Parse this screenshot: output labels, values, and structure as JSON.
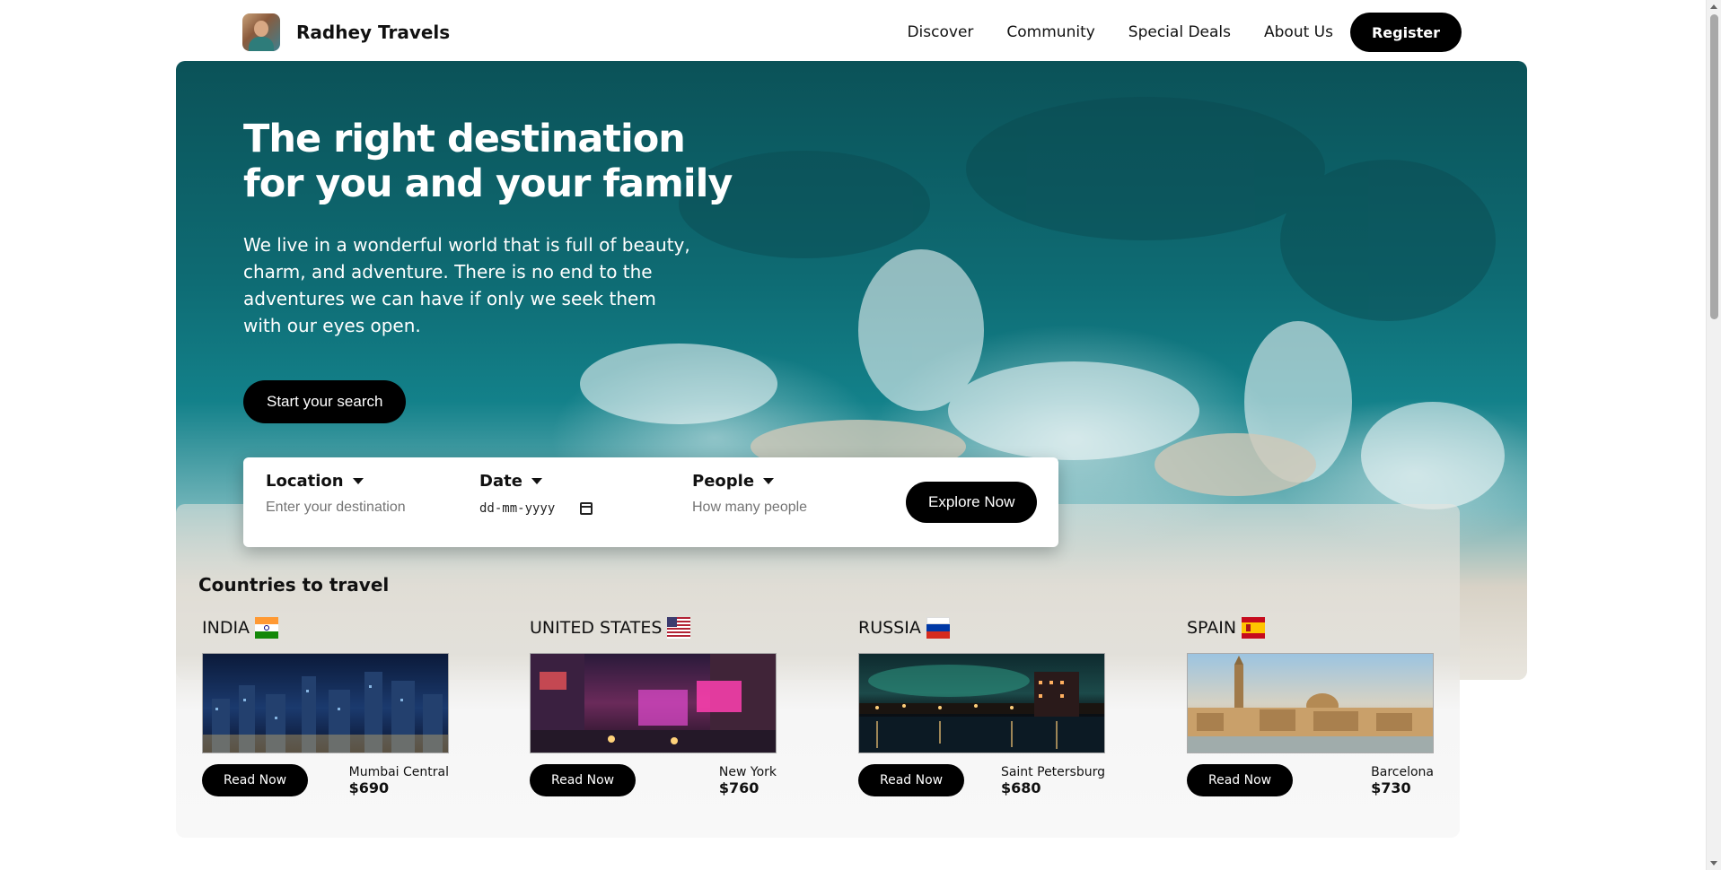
{
  "header": {
    "brand": "Radhey Travels",
    "nav": [
      "Discover",
      "Community",
      "Special Deals",
      "About Us"
    ],
    "register_label": "Register"
  },
  "hero": {
    "title": "The right destination for you and your family",
    "text": "We live in a wonderful world that is full of beauty, charm, and adventure. There is no end to the adventures we can have if only we seek them with our eyes open.",
    "button_label": "Start your search"
  },
  "search": {
    "location_label": "Location",
    "location_placeholder": "Enter your destination",
    "date_label": "Date",
    "date_placeholder": "dd-mm-yyyy",
    "people_label": "People",
    "people_placeholder": "How many people",
    "explore_label": "Explore Now"
  },
  "countries": {
    "title": "Countries to travel",
    "items": [
      {
        "name": "INDIA",
        "city": "Mumbai Central",
        "price": "$690",
        "button": "Read Now"
      },
      {
        "name": "UNITED STATES",
        "city": "New York",
        "price": "$760",
        "button": "Read Now"
      },
      {
        "name": "RUSSIA",
        "city": "Saint Petersburg",
        "price": "$680",
        "button": "Read Now"
      },
      {
        "name": "SPAIN",
        "city": "Barcelona",
        "price": "$730",
        "button": "Read Now"
      }
    ]
  },
  "colors": {
    "primary_button": "#000000",
    "ocean_dark": "#0b5258",
    "ocean_light": "#13818a"
  }
}
